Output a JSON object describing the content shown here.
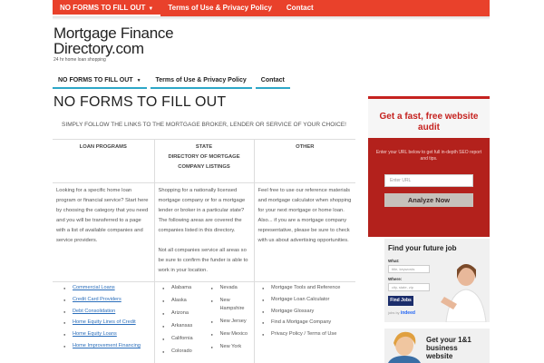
{
  "topnav": {
    "items": [
      {
        "label": "NO FORMS TO FILL OUT",
        "has_dropdown": true
      },
      {
        "label": "Terms of Use & Privacy Policy"
      },
      {
        "label": "Contact"
      }
    ],
    "bg_color": "#e9412b"
  },
  "site": {
    "title": "Mortgage Finance Directory.com",
    "tagline": "24 hr home loan shopping"
  },
  "subnav": {
    "items": [
      {
        "label": "NO FORMS TO FILL OUT",
        "has_dropdown": true
      },
      {
        "label": "Terms of Use & Privacy Policy"
      },
      {
        "label": "Contact"
      }
    ],
    "accent_color": "#2da7c7"
  },
  "main": {
    "title": "NO FORMS TO FILL OUT",
    "intro": "SIMPLY FOLLOW THE LINKS TO THE MORTGAGE BROKER, LENDER OR SERVICE OF YOUR CHOICE!",
    "headers": {
      "col1": "LOAN PROGRAMS",
      "col2_line1": "STATE",
      "col2_line2": "DIRECTORY OF MORTGAGE COMPANY LISTINGS",
      "col3": "OTHER"
    },
    "descriptions": {
      "col1": "Looking for a specific home loan program or financial service? Start here by choosing the category that you need and you will be transferred to a page with a list of available companies and service providers.",
      "col2_p1": "Shopping for a nationally licensed mortgage company or for a mortgage lender or broker in a particular state?   The following areas are covered  the companies listed in this directory.",
      "col2_p2": "Not all companies service all areas so be sure to confirm the funder is able to work in your location.",
      "col3": "Feel free to use our reference materials and mortgage calculator when shopping for your next mortgage or home loan. Also... if you are a mortgage company representative, please be sure to check with us about advertising opportunities."
    },
    "loan_programs": [
      "Commercial Loans",
      "Credit Card Providers",
      "Debt Consolidation",
      "Home Equity Lines of Credit",
      "Home Equity Loans",
      "Home Improvement Financing"
    ],
    "states_a": [
      "Alabama",
      "Alaska",
      "Arizona",
      "Arkansas",
      "California",
      "Colorado"
    ],
    "states_b": [
      "Nevada",
      "New Hampshire",
      "New Jersey",
      "New Mexico",
      "New York"
    ],
    "other": [
      "Mortgage Tools and Reference",
      "Mortgage Loan Calculator",
      "Mortgage Glossary",
      "Find a Mortgage Company",
      "Privacy Policy / Terms of Use"
    ],
    "link_color": "#2a6ebb"
  },
  "audit": {
    "title": "Get a fast, free website audit",
    "text": "Enter your URL below to get full in-depth SEO report and tips.",
    "input_placeholder": "Enter URL",
    "button": "Analyze Now",
    "accent_color": "#c5221f"
  },
  "jobad": {
    "title": "Find your future job",
    "what_label": "What:",
    "what_placeholder": "title, keywords",
    "where_label": "Where:",
    "where_placeholder": "city, state, zip",
    "button": "Find Jobs",
    "jobs_by": "jobs by",
    "brand": "indeed"
  },
  "ad11": {
    "text": "Get your 1&1 business website"
  }
}
